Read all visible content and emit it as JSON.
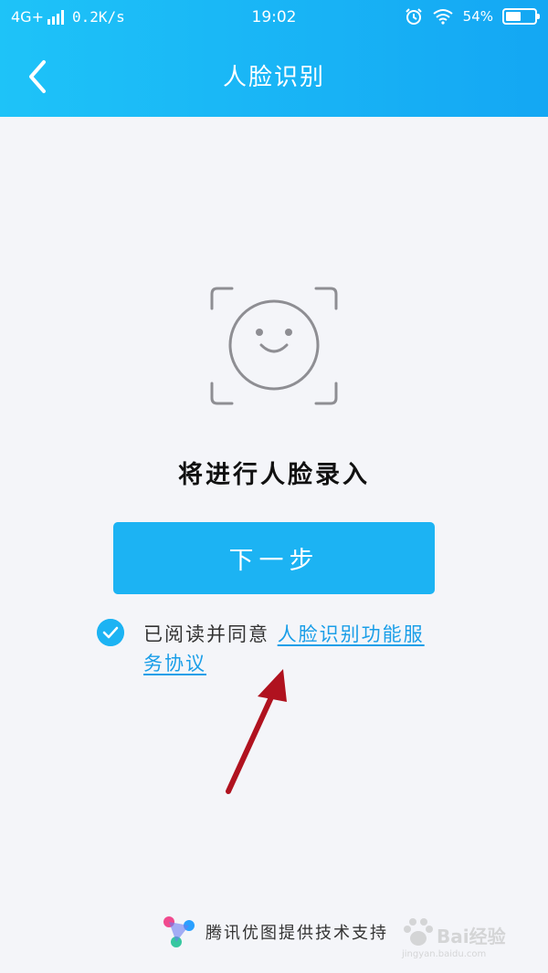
{
  "status_bar": {
    "network": "4G+",
    "speed": "0.2K/s",
    "time": "19:02",
    "battery": "54%",
    "battery_level": 0.54
  },
  "header": {
    "title": "人脸识别",
    "background_start": "#1ec3f8",
    "background_end": "#14a7f3"
  },
  "main": {
    "prompt": "将进行人脸录入",
    "next_button_label": "下一步",
    "agreement_prefix": "已阅读并同意 ",
    "agreement_link": "人脸识别功能服务协议",
    "accent_color": "#1cb3f3"
  },
  "footer": {
    "provider": "腾讯优图提供技术支持"
  },
  "watermark": {
    "brand": "Bai经验",
    "url": "jingyan.baidu.com"
  }
}
